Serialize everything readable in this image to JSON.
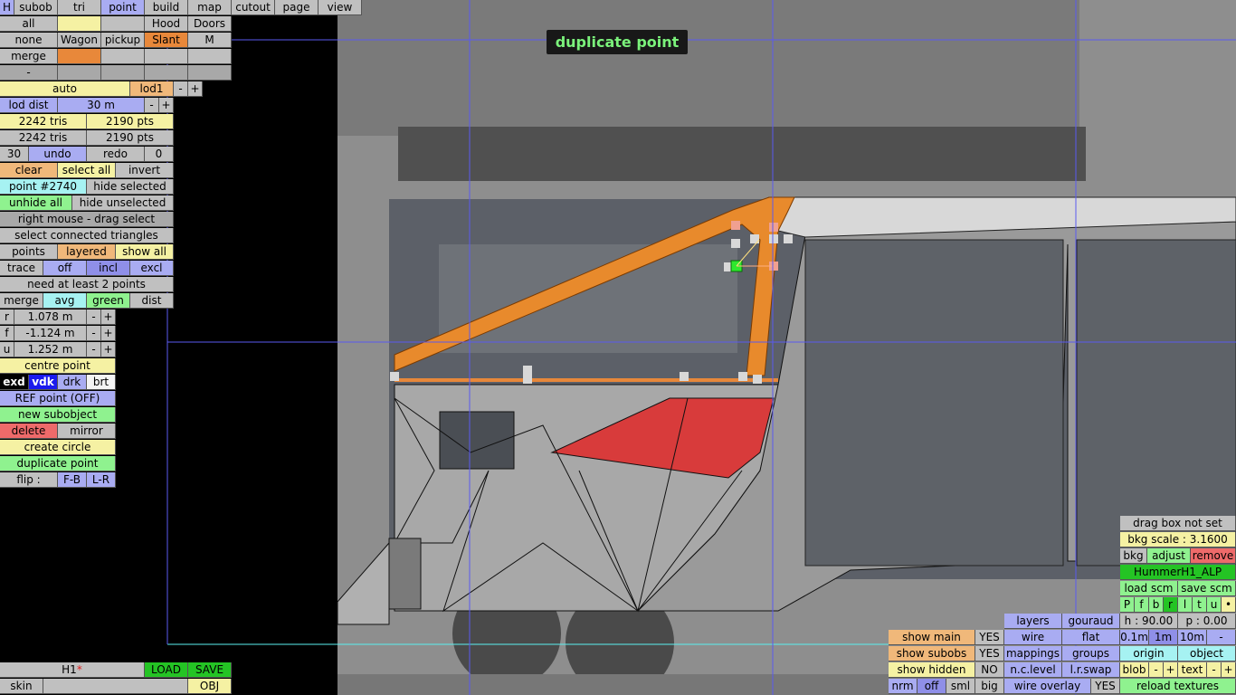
{
  "toast": "duplicate point",
  "colors": {
    "accent_point": "#a9acf2",
    "selected_orange": "#e8883a",
    "green": "#8ff28f",
    "red": "#ee6a6a"
  },
  "top_tabs": [
    "H",
    "subob",
    "tri",
    "point",
    "build",
    "map",
    "cutout",
    "page",
    "view"
  ],
  "row2": [
    "all",
    "",
    "Hood",
    "Doors"
  ],
  "row3": [
    "none",
    "Wagon",
    "pickup",
    "Slant",
    "M"
  ],
  "row4": [
    "merge"
  ],
  "row5": [
    "-"
  ],
  "lod": {
    "auto": "auto",
    "name": "lod1",
    "minus": "-",
    "plus": "+",
    "dist_label": "lod dist",
    "dist_value": "30 m"
  },
  "stats": {
    "tris1": "2242 tris",
    "pts1": "2190 pts",
    "tris2": "2242 tris",
    "pts2": "2190 pts"
  },
  "undo_row": {
    "count": "30",
    "undo": "undo",
    "redo": "redo",
    "redo_count": "0"
  },
  "select_row": {
    "clear": "clear",
    "select_all": "select all",
    "invert": "invert"
  },
  "point_row": {
    "point": "point #2740",
    "hide_selected": "hide selected"
  },
  "hide_row": {
    "unhide_all": "unhide all",
    "hide_unselected": "hide unselected"
  },
  "right_mouse": "right mouse - drag select",
  "select_connected": "select connected triangles",
  "points_row": {
    "points": "points",
    "layered": "layered",
    "show_all": "show all"
  },
  "trace_row": {
    "trace": "trace",
    "off": "off",
    "incl": "incl",
    "excl": "excl"
  },
  "need_points": "need at least 2 points",
  "merge_row": {
    "merge": "merge",
    "avg": "avg",
    "green": "green",
    "dist": "dist"
  },
  "coords": [
    {
      "axis": "r",
      "value": "1.078 m"
    },
    {
      "axis": "f",
      "value": "-1.124 m"
    },
    {
      "axis": "u",
      "value": "1.252 m"
    }
  ],
  "centre_point": "centre point",
  "modes": {
    "exd": "exd",
    "vdk": "vdk",
    "drk": "drk",
    "brt": "brt"
  },
  "ref_point": "REF point (OFF)",
  "new_subobject": "new subobject",
  "delete_mirror": {
    "delete": "delete",
    "mirror": "mirror"
  },
  "create_circle": "create circle",
  "duplicate_point": "duplicate point",
  "flip": {
    "label": "flip :",
    "fb": "F-B",
    "lr": "L-R"
  },
  "bottom_left": {
    "file": "H1",
    "modified": "*",
    "load": "LOAD",
    "save": "SAVE",
    "skin": "skin",
    "obj": "OBJ"
  },
  "right_panel": {
    "drag_box": "drag box not set",
    "bkg_scale": "bkg scale : 3.1600",
    "bkg": "bkg",
    "adjust": "adjust",
    "remove": "remove",
    "scm_name": "HummerH1_ALP",
    "load_scm": "load scm",
    "save_scm": "save scm",
    "views": [
      "P",
      "f",
      "b",
      "r",
      "l",
      "t",
      "u",
      "•"
    ],
    "h": "h : 90.00",
    "p": "p : 0.00",
    "grid": [
      "0.1m",
      "1m",
      "10m",
      "-"
    ],
    "origin": "origin",
    "object": "object",
    "blob": "blob",
    "text": "text",
    "minus": "-",
    "plus": "+",
    "reload": "reload textures"
  },
  "display_panel": {
    "show_main": "show main",
    "show_main_v": "YES",
    "show_subobs": "show subobs",
    "show_subobs_v": "YES",
    "show_hidden": "show hidden",
    "show_hidden_v": "NO",
    "nrm": "nrm",
    "off": "off",
    "sml": "sml",
    "big": "big",
    "layers": "layers",
    "gouraud": "gouraud",
    "wire": "wire",
    "flat": "flat",
    "mappings": "mappings",
    "groups": "groups",
    "nc_level": "n.c.level",
    "lr_swap": "l.r.swap",
    "wire_overlay": "wire overlay",
    "wire_overlay_v": "YES"
  }
}
